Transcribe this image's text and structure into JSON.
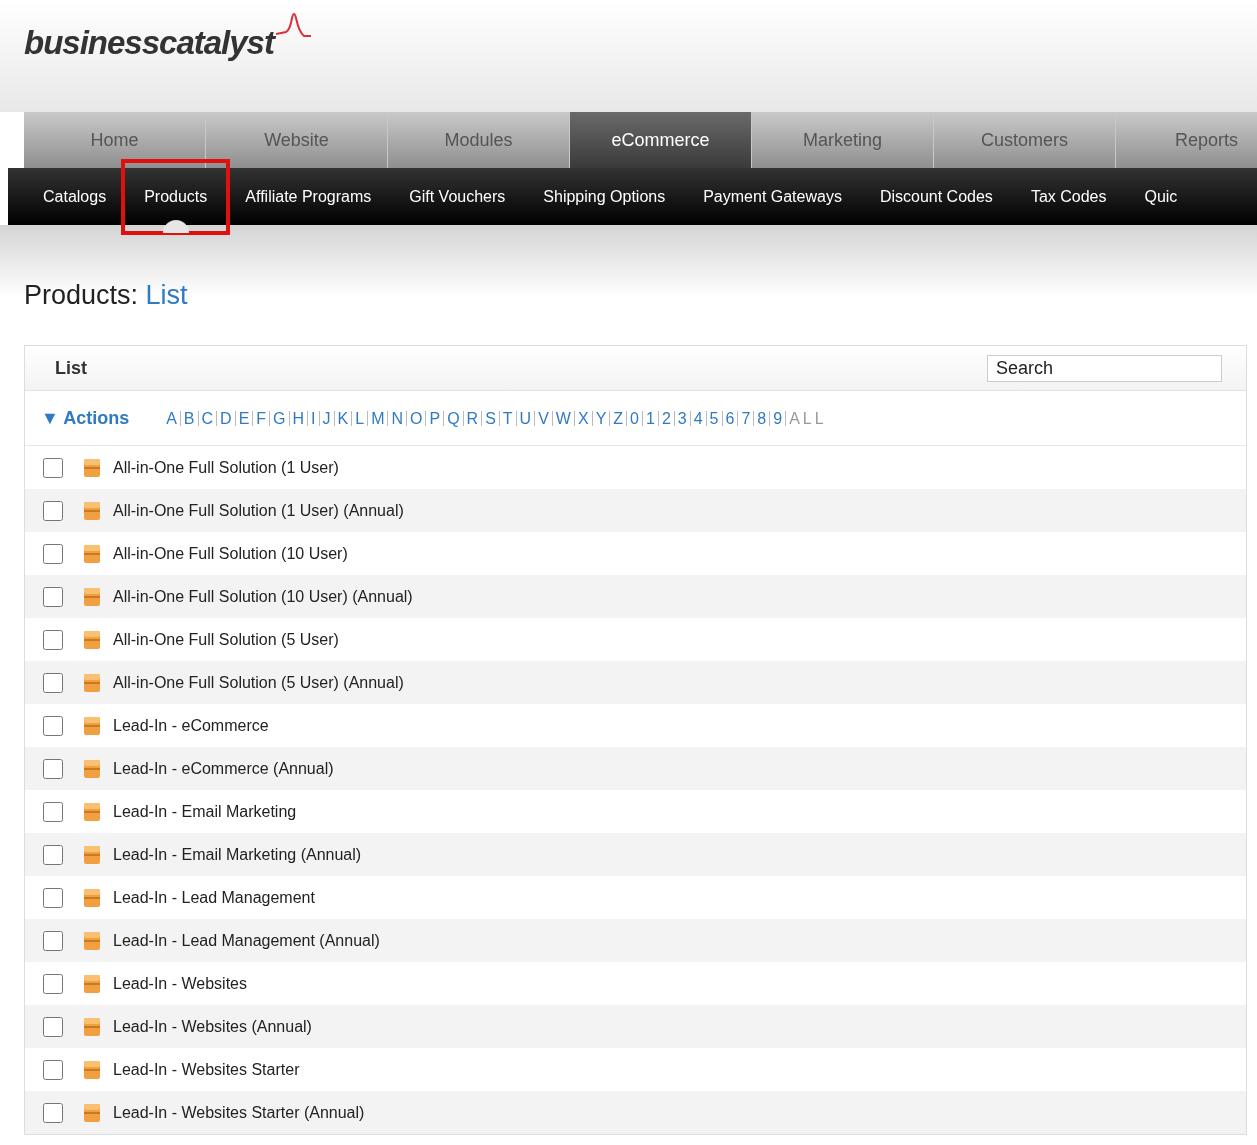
{
  "logo": {
    "text": "businesscatalyst"
  },
  "main_tabs": [
    {
      "label": "Home",
      "selected": false
    },
    {
      "label": "Website",
      "selected": false
    },
    {
      "label": "Modules",
      "selected": false
    },
    {
      "label": "eCommerce",
      "selected": true
    },
    {
      "label": "Marketing",
      "selected": false
    },
    {
      "label": "Customers",
      "selected": false
    },
    {
      "label": "Reports",
      "selected": false
    }
  ],
  "sub_tabs": [
    {
      "label": "Catalogs",
      "selected": false,
      "highlighted": false
    },
    {
      "label": "Products",
      "selected": true,
      "highlighted": true
    },
    {
      "label": "Affiliate Programs",
      "selected": false,
      "highlighted": false
    },
    {
      "label": "Gift Vouchers",
      "selected": false,
      "highlighted": false
    },
    {
      "label": "Shipping Options",
      "selected": false,
      "highlighted": false
    },
    {
      "label": "Payment Gateways",
      "selected": false,
      "highlighted": false
    },
    {
      "label": "Discount Codes",
      "selected": false,
      "highlighted": false
    },
    {
      "label": "Tax Codes",
      "selected": false,
      "highlighted": false
    },
    {
      "label": "Quic",
      "selected": false,
      "highlighted": false
    }
  ],
  "heading": {
    "section": "Products:",
    "view": "List"
  },
  "panel": {
    "title": "List",
    "search": {
      "value": "Search"
    },
    "actions": "▼ Actions",
    "letters": [
      {
        "label": "A",
        "selected": false
      },
      {
        "label": "B",
        "selected": false
      },
      {
        "label": "C",
        "selected": false
      },
      {
        "label": "D",
        "selected": false
      },
      {
        "label": "E",
        "selected": false
      },
      {
        "label": "F",
        "selected": false
      },
      {
        "label": "G",
        "selected": false
      },
      {
        "label": "H",
        "selected": false
      },
      {
        "label": "I",
        "selected": false
      },
      {
        "label": "J",
        "selected": false
      },
      {
        "label": "K",
        "selected": false
      },
      {
        "label": "L",
        "selected": false
      },
      {
        "label": "M",
        "selected": false
      },
      {
        "label": "N",
        "selected": false
      },
      {
        "label": "O",
        "selected": false
      },
      {
        "label": "P",
        "selected": false
      },
      {
        "label": "Q",
        "selected": false
      },
      {
        "label": "R",
        "selected": false
      },
      {
        "label": "S",
        "selected": false
      },
      {
        "label": "T",
        "selected": false
      },
      {
        "label": "U",
        "selected": false
      },
      {
        "label": "V",
        "selected": false
      },
      {
        "label": "W",
        "selected": false
      },
      {
        "label": "X",
        "selected": false
      },
      {
        "label": "Y",
        "selected": false
      },
      {
        "label": "Z",
        "selected": false
      },
      {
        "label": "0",
        "selected": false
      },
      {
        "label": "1",
        "selected": false
      },
      {
        "label": "2",
        "selected": false
      },
      {
        "label": "3",
        "selected": false
      },
      {
        "label": "4",
        "selected": false
      },
      {
        "label": "5",
        "selected": false
      },
      {
        "label": "6",
        "selected": false
      },
      {
        "label": "7",
        "selected": false
      },
      {
        "label": "8",
        "selected": false
      },
      {
        "label": "9",
        "selected": false
      },
      {
        "label": "ALL",
        "selected": true
      }
    ],
    "items": [
      {
        "name": "All-in-One Full Solution (1 User)",
        "checked": false
      },
      {
        "name": "All-in-One Full Solution (1 User) (Annual)",
        "checked": false
      },
      {
        "name": "All-in-One Full Solution (10 User)",
        "checked": false
      },
      {
        "name": "All-in-One Full Solution (10 User) (Annual)",
        "checked": false
      },
      {
        "name": "All-in-One Full Solution (5 User)",
        "checked": false
      },
      {
        "name": "All-in-One Full Solution (5 User) (Annual)",
        "checked": false
      },
      {
        "name": "Lead-In - eCommerce",
        "checked": false
      },
      {
        "name": "Lead-In - eCommerce (Annual)",
        "checked": false
      },
      {
        "name": "Lead-In - Email Marketing",
        "checked": false
      },
      {
        "name": "Lead-In - Email Marketing (Annual)",
        "checked": false
      },
      {
        "name": "Lead-In - Lead Management",
        "checked": false
      },
      {
        "name": "Lead-In - Lead Management (Annual)",
        "checked": false
      },
      {
        "name": "Lead-In - Websites",
        "checked": false
      },
      {
        "name": "Lead-In - Websites (Annual)",
        "checked": false
      },
      {
        "name": "Lead-In - Websites Starter",
        "checked": false
      },
      {
        "name": "Lead-In - Websites Starter (Annual)",
        "checked": false
      }
    ]
  }
}
